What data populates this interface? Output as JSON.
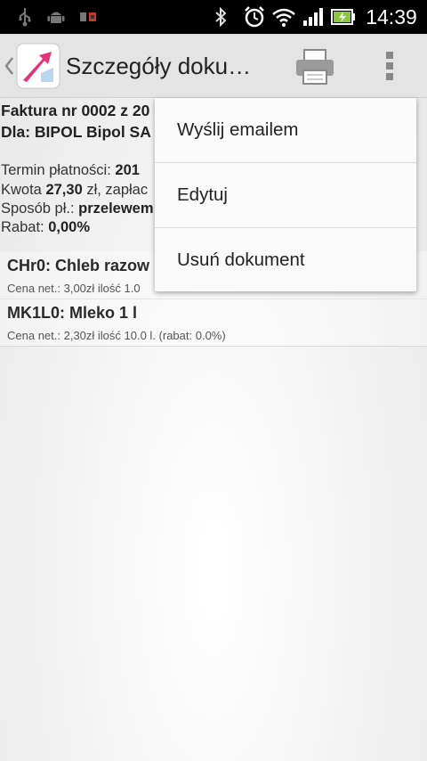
{
  "status_bar": {
    "time": "14:39",
    "icons": [
      "usb-icon",
      "android-debug-icon",
      "sim-icon",
      "bluetooth-icon",
      "alarm-icon",
      "wifi-icon",
      "signal-icon",
      "battery-charging-icon"
    ]
  },
  "action_bar": {
    "title": "Szczegóły doku…",
    "icons": [
      "up-chevron-icon",
      "app-logo-icon",
      "printer-icon",
      "overflow-menu-icon"
    ]
  },
  "document": {
    "title_line1": "Faktura nr 0002 z 20",
    "title_line2": "Dla: BIPOL Bipol SA",
    "due_label": "Termin płatności: ",
    "due_value": "201",
    "amount_label": "Kwota ",
    "amount_value": "27,30",
    "amount_suffix": " zł, zapłac",
    "payment_label": "Sposób pł.: ",
    "payment_value": "przelewem",
    "discount_label": "Rabat: ",
    "discount_value": "0,00%"
  },
  "items": [
    {
      "name": "CHr0: Chleb razow",
      "meta": "Cena net.: 3,00zł  ilość 1.0"
    },
    {
      "name": "MK1L0: Mleko 1 l",
      "meta": "Cena net.: 2,30zł  ilość 10.0 l. (rabat: 0.0%)"
    }
  ],
  "menu": {
    "items": [
      "Wyślij emailem",
      "Edytuj",
      "Usuń dokument"
    ]
  },
  "colors": {
    "status_bar_bg": "#000000",
    "action_bar_bg": "#e4e4e4",
    "logo_accent": "#e8317c",
    "battery_accent": "#8cc63f"
  }
}
